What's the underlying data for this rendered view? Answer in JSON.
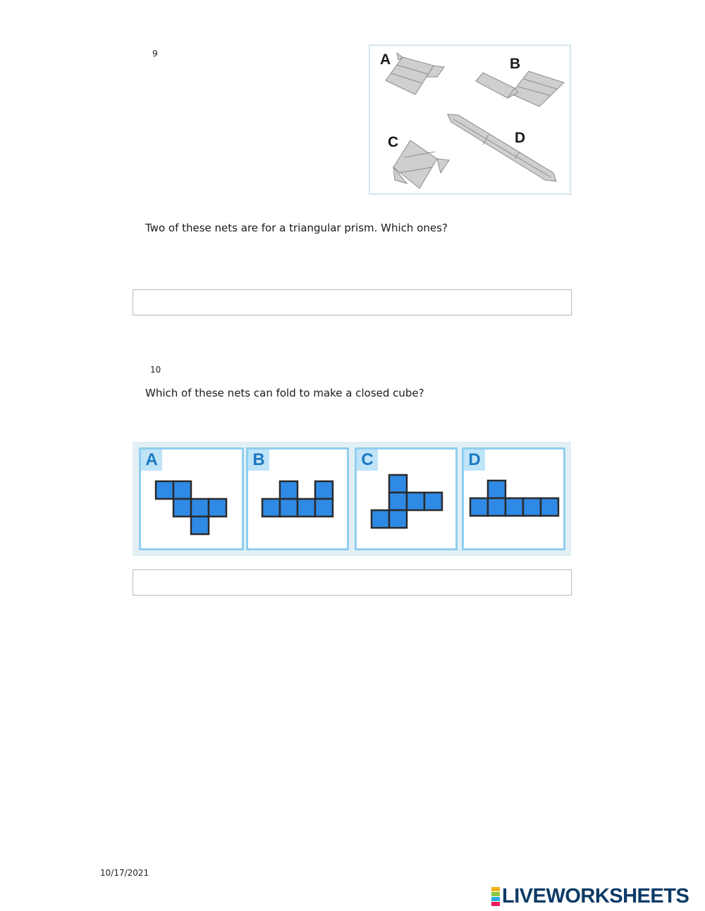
{
  "question9": {
    "number": "9",
    "prompt": "Two of these nets are for a triangular prism. Which ones?",
    "net_labels": [
      "A",
      "B",
      "C",
      "D"
    ],
    "answer": ""
  },
  "question10": {
    "number": "10",
    "prompt": "Which of these nets can fold to make a closed cube?",
    "net_labels": [
      "A",
      "B",
      "C",
      "D"
    ],
    "answer": ""
  },
  "footer": {
    "date": "10/17/2021",
    "logo_text": "LIVEWORKSHEETS",
    "logo_block_letters": [
      "L",
      "I",
      "V",
      "E"
    ]
  },
  "colors": {
    "cube_square_fill": "#2f8ae5",
    "cube_square_stroke": "#2b2b2b",
    "panel_border": "#8fcff0",
    "letter_color": "#1c78c0",
    "prism_fill": "#cfcfcf",
    "prism_stroke": "#8c8c8c",
    "logo_text": "#0c3a66",
    "logo_blocks": [
      "#f2b21b",
      "#8cc63f",
      "#29abe2",
      "#ec1c5a"
    ]
  }
}
